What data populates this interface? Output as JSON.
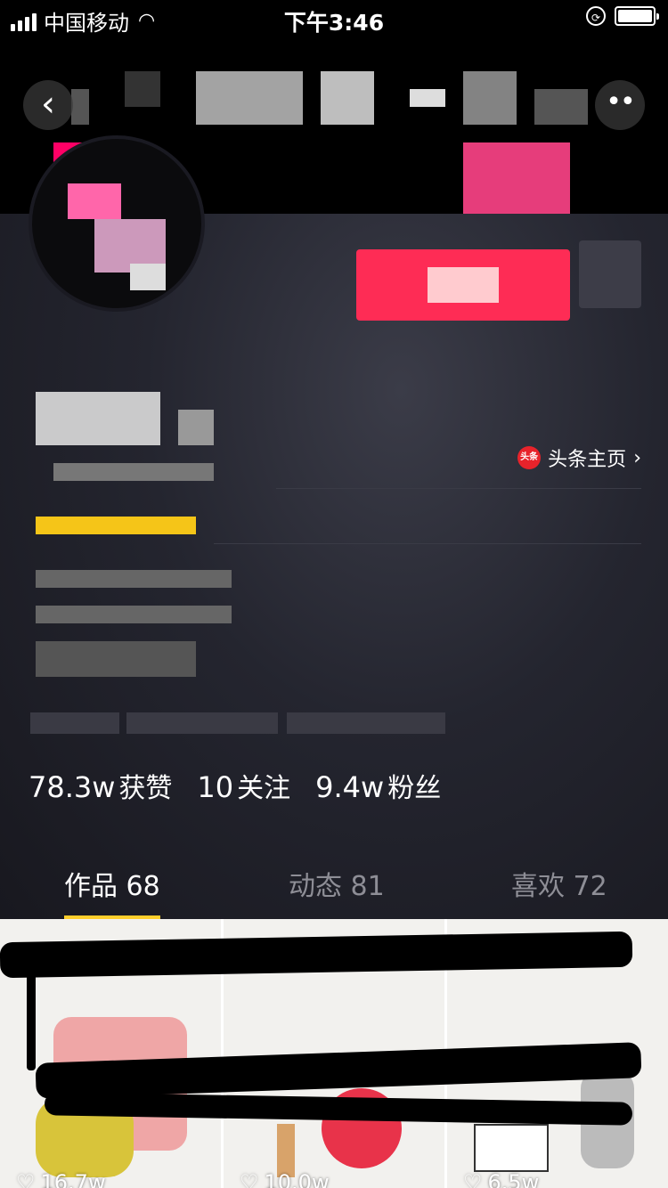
{
  "status_bar": {
    "carrier": "中国移动",
    "time": "下午3:46"
  },
  "profile": {
    "toutiao_link": "头条主页",
    "toutiao_badge": "头条",
    "stats": [
      {
        "value": "78.3w",
        "label": "获赞"
      },
      {
        "value": "10",
        "label": "关注"
      },
      {
        "value": "9.4w",
        "label": "粉丝"
      }
    ]
  },
  "tabs": [
    {
      "label": "作品 68"
    },
    {
      "label": "动态 81"
    },
    {
      "label": "喜欢 72"
    }
  ],
  "grid": [
    {
      "likes": "16.7w"
    },
    {
      "likes": "10.0w"
    },
    {
      "likes": "6.5w"
    }
  ],
  "colors": {
    "follow_button": "#fe2c55",
    "tab_indicator": "#fece2b",
    "background": "#16161f"
  }
}
